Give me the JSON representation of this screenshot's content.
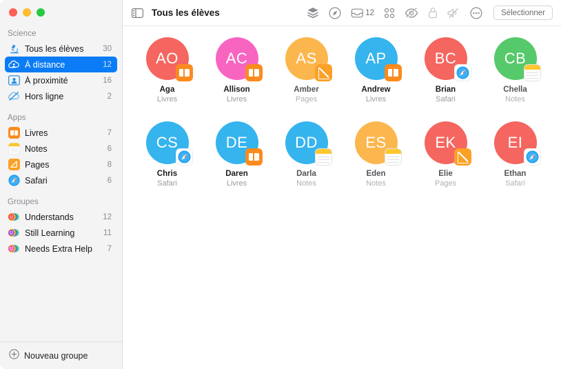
{
  "window": {
    "controls": [
      "close",
      "minimize",
      "maximize"
    ]
  },
  "sidebar": {
    "sections": [
      {
        "title": "Science",
        "items": [
          {
            "label": "Tous les élèves",
            "count": "30",
            "icon": "microscope-icon",
            "selected": false
          },
          {
            "label": "À distance",
            "count": "12",
            "icon": "cloud-person-icon",
            "selected": true
          },
          {
            "label": "À proximité",
            "count": "16",
            "icon": "person-frame-icon",
            "selected": false
          },
          {
            "label": "Hors ligne",
            "count": "2",
            "icon": "cloud-slash-icon",
            "selected": false
          }
        ]
      },
      {
        "title": "Apps",
        "items": [
          {
            "label": "Livres",
            "count": "7",
            "icon": "books-app-icon",
            "selected": false
          },
          {
            "label": "Notes",
            "count": "6",
            "icon": "notes-app-icon",
            "selected": false
          },
          {
            "label": "Pages",
            "count": "8",
            "icon": "pages-app-icon",
            "selected": false
          },
          {
            "label": "Safari",
            "count": "6",
            "icon": "safari-app-icon",
            "selected": false
          }
        ]
      },
      {
        "title": "Groupes",
        "items": [
          {
            "label": "Understands",
            "count": "12",
            "icon": "group-red-icon",
            "selected": false
          },
          {
            "label": "Still Learning",
            "count": "11",
            "icon": "group-purple-icon",
            "selected": false
          },
          {
            "label": "Needs Extra Help",
            "count": "7",
            "icon": "group-pink-icon",
            "selected": false
          }
        ]
      }
    ],
    "new_group_label": "Nouveau groupe",
    "new_group_icon": "plus-circle-icon"
  },
  "toolbar": {
    "sidebar_toggle_icon": "sidebar-toggle-icon",
    "title": "Tous les élèves",
    "icons": [
      {
        "name": "layers-icon",
        "glyph": "layers"
      },
      {
        "name": "navigate-icon",
        "glyph": "compass"
      },
      {
        "name": "inbox-icon",
        "glyph": "inbox",
        "badge": "12"
      },
      {
        "name": "grid-view-icon",
        "glyph": "grid"
      },
      {
        "name": "hide-screen-icon",
        "glyph": "eye-slash"
      },
      {
        "name": "lock-icon",
        "glyph": "lock"
      },
      {
        "name": "mute-icon",
        "glyph": "speaker-slash"
      },
      {
        "name": "more-icon",
        "glyph": "ellipsis-circle"
      }
    ],
    "select_button_label": "Sélectionner"
  },
  "colors": {
    "accent": "#0b7cf5",
    "sidebar_bg": "#f4f4f5",
    "avatar_red": "#f4665f",
    "avatar_pink": "#f765c0",
    "avatar_orange": "#fcb64e",
    "avatar_blue": "#35b4ee",
    "avatar_green": "#56c96a",
    "badge_orange": "#fb8b1e",
    "badge_yellow": "#fdc72f"
  },
  "students": [
    {
      "initials": "AO",
      "name": "Aga",
      "app": "Livres",
      "color": "#f4665f",
      "badge": "books",
      "badge_name": "books-badge-icon",
      "dim": false
    },
    {
      "initials": "AC",
      "name": "Allison",
      "app": "Livres",
      "color": "#f765c0",
      "badge": "books",
      "badge_name": "books-badge-icon",
      "dim": false
    },
    {
      "initials": "AS",
      "name": "Amber",
      "app": "Pages",
      "color": "#fcb64e",
      "badge": "pages",
      "badge_name": "pages-badge-icon",
      "dim": true
    },
    {
      "initials": "AP",
      "name": "Andrew",
      "app": "Livres",
      "color": "#35b4ee",
      "badge": "books",
      "badge_name": "books-badge-icon",
      "dim": false
    },
    {
      "initials": "BC",
      "name": "Brian",
      "app": "Safari",
      "color": "#f4665f",
      "badge": "safari",
      "badge_name": "safari-badge-icon",
      "dim": false
    },
    {
      "initials": "CB",
      "name": "Chella",
      "app": "Notes",
      "color": "#56c96a",
      "badge": "notes",
      "badge_name": "notes-badge-icon",
      "dim": true
    },
    {
      "initials": "CS",
      "name": "Chris",
      "app": "Safari",
      "color": "#35b4ee",
      "badge": "safari",
      "badge_name": "safari-badge-icon",
      "dim": false
    },
    {
      "initials": "DE",
      "name": "Daren",
      "app": "Livres",
      "color": "#35b4ee",
      "badge": "books",
      "badge_name": "books-badge-icon",
      "dim": false
    },
    {
      "initials": "DD",
      "name": "Darla",
      "app": "Notes",
      "color": "#35b4ee",
      "badge": "notes",
      "badge_name": "notes-badge-icon",
      "dim": true
    },
    {
      "initials": "ES",
      "name": "Eden",
      "app": "Notes",
      "color": "#fcb64e",
      "badge": "notes",
      "badge_name": "notes-badge-icon",
      "dim": true
    },
    {
      "initials": "EK",
      "name": "Elie",
      "app": "Pages",
      "color": "#f4665f",
      "badge": "pages",
      "badge_name": "pages-badge-icon",
      "dim": true
    },
    {
      "initials": "EI",
      "name": "Ethan",
      "app": "Safari",
      "color": "#f4665f",
      "badge": "safari",
      "badge_name": "safari-badge-icon",
      "dim": true
    }
  ]
}
